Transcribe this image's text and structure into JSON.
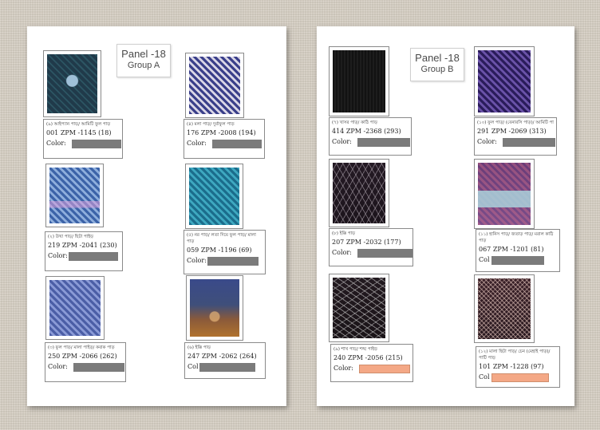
{
  "panels": [
    {
      "title": "Panel -18",
      "group": "Group A",
      "items": [
        {
          "name": "(৯) আইপ্যান পাড়/ আমিটি ফুল পাড়",
          "code": "001 ZPM -1145 (18)",
          "color_label": "Color:"
        },
        {
          "name": "(৪) মলা পাড়/ দুর্বাফুল পাড়",
          "code": "176 ZPM -2008 (194)",
          "color_label": "Color:"
        },
        {
          "name": "(২) উখা পাড়/ ছিটা পাইড়",
          "code": "219 ZPM -2041 (230)",
          "color_label": "Color:"
        },
        {
          "name": "(৫) নর পাড়/ লতা দিয়ে ফুল পাড়/ মালা পাড়",
          "code": "059 ZPM -1196 (69)",
          "color_label": "Color:"
        },
        {
          "name": "(৩) ফুল পাড়/ মালা পাইড়/ কবাক পাড়",
          "code": "250 ZPM -2066 (262)",
          "color_label": "Color:"
        },
        {
          "name": "(৬) ইক্কি পাড়",
          "code": "247 ZPM -2062 (264)",
          "color_label": "Col"
        }
      ]
    },
    {
      "title": "Panel -18",
      "group": "Group B",
      "items": [
        {
          "name": "(৭) খাসর পাড়/ কাঠি পাড়",
          "code": "414 ZPM -2368 (293)",
          "color_label": "Color:"
        },
        {
          "name": "(১০) ফুল পাড়/ (বেনারসি পাড়)/ আমিটি পাড়",
          "code": "291 ZPM -2069 (313)",
          "color_label": "Color:"
        },
        {
          "name": "(৮) ইক্কি পাড়",
          "code": "207 ZPM -2032 (177)",
          "color_label": "Color:"
        },
        {
          "name": "(১১) হানিস পাড়/ জতাড় পাড়/ মরাল কাঠি পাড়",
          "code": "067 ZPM -1201 (81)",
          "color_label": "Col"
        },
        {
          "name": "(৯) শাখ পাড়/ শঙ্খ পাইড়",
          "code": "240 ZPM -2056 (215)",
          "color_label": "Color:"
        },
        {
          "name": "(১২) মালা ছিটা পাড়/ চেন (মেহাই পাড়)/ পাটি পাড়",
          "code": "101 ZPM -1228 (97)",
          "color_label": "Col"
        }
      ]
    }
  ],
  "colors": {
    "background": "#d7d0c4",
    "color_bar_gray": "#7b7b7b",
    "color_bar_peach": "#f4a886"
  }
}
